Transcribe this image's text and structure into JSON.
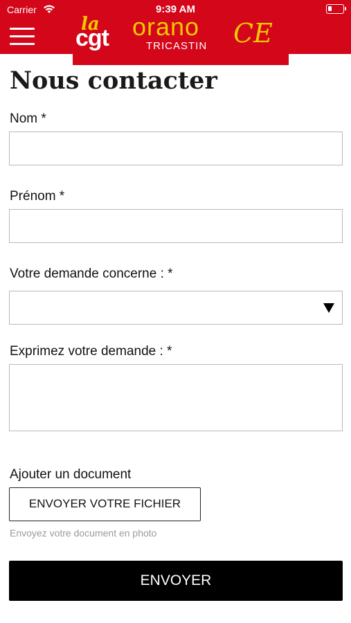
{
  "status_bar": {
    "carrier": "Carrier",
    "time": "9:39 AM"
  },
  "header": {
    "logo": {
      "la": "la",
      "cgt": "cgt",
      "orano": "orano",
      "tricastin": "TRICASTIN",
      "ce": "CE"
    },
    "brand_color": "#d3061a",
    "accent_color": "#f2c800"
  },
  "page": {
    "title": "Nous contacter"
  },
  "form": {
    "nom_label": "Nom *",
    "nom_value": "",
    "prenom_label": "Prénom *",
    "prenom_value": "",
    "demande_concerne_label": "Votre demande concerne : *",
    "demande_concerne_value": "",
    "exprimez_label": "Exprimez votre demande : *",
    "exprimez_value": "",
    "document_label": "Ajouter un document",
    "file_button_label": "ENVOYER VOTRE FICHIER",
    "file_hint": "Envoyez votre document en photo",
    "submit_label": "ENVOYER"
  },
  "icons": {
    "menu": "hamburger-menu-icon",
    "wifi": "wifi-icon",
    "battery": "battery-icon",
    "dropdown": "triangle-down-icon"
  }
}
